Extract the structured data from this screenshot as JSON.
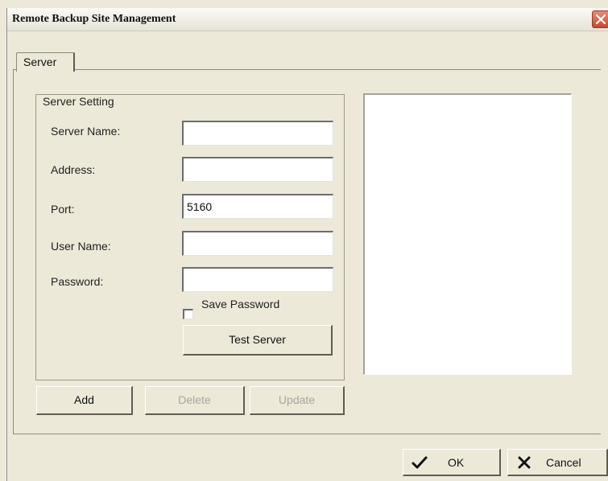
{
  "window": {
    "title": "Remote Backup Site Management"
  },
  "tabs": [
    {
      "label": "Server"
    }
  ],
  "server_setting": {
    "group_title": "Server Setting",
    "fields": [
      {
        "label": "Server Name:",
        "value": ""
      },
      {
        "label": "Address:",
        "value": ""
      },
      {
        "label": "Port:",
        "value": "5160"
      },
      {
        "label": "User Name:",
        "value": ""
      },
      {
        "label": "Password:",
        "value": ""
      }
    ],
    "save_password": {
      "label": "Save Password",
      "checked": false
    },
    "test_server_label": "Test Server"
  },
  "buttons": {
    "add": "Add",
    "delete": "Delete",
    "update": "Update"
  },
  "footer": {
    "ok": "OK",
    "cancel": "Cancel"
  },
  "icons": {
    "close": "close-icon",
    "ok": "checkmark-icon",
    "cancel": "x-mark-icon"
  }
}
